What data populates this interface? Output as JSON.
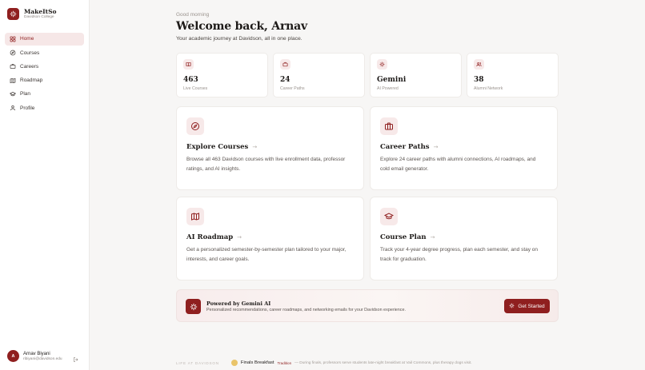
{
  "app": {
    "name": "MakeItSo",
    "subtitle": "Davidson College",
    "accent": "#8f1f1f"
  },
  "sidebar": {
    "items": [
      {
        "label": "Home",
        "icon": "grid-icon",
        "active": true
      },
      {
        "label": "Courses",
        "icon": "compass-icon"
      },
      {
        "label": "Careers",
        "icon": "briefcase-icon"
      },
      {
        "label": "Roadmap",
        "icon": "map-icon"
      },
      {
        "label": "Plan",
        "icon": "graduation-cap-icon"
      },
      {
        "label": "Profile",
        "icon": "user-icon"
      }
    ]
  },
  "user": {
    "initial": "A",
    "name": "Arnav Biyani",
    "email": "ribiyani@davidson.edu"
  },
  "header": {
    "greeting": "Good morning",
    "title": "Welcome back, Arnav",
    "subtitle": "Your academic journey at Davidson, all in one place."
  },
  "stats": [
    {
      "value": "463",
      "label": "Live Courses",
      "icon": "book-icon"
    },
    {
      "value": "24",
      "label": "Career Paths",
      "icon": "briefcase-icon"
    },
    {
      "value": "Gemini",
      "label": "AI Powered",
      "icon": "sparkle-icon"
    },
    {
      "value": "38",
      "label": "Alumni Network",
      "icon": "users-icon"
    }
  ],
  "cards": [
    {
      "title": "Explore Courses",
      "desc": "Browse all 463 Davidson courses with live enrollment data, professor ratings, and AI insights.",
      "icon": "compass-icon"
    },
    {
      "title": "Career Paths",
      "desc": "Explore 24 career paths with alumni connections, AI roadmaps, and cold email generator.",
      "icon": "briefcase-icon"
    },
    {
      "title": "AI Roadmap",
      "desc": "Get a personalized semester-by-semester plan tailored to your major, interests, and career goals.",
      "icon": "map-icon"
    },
    {
      "title": "Course Plan",
      "desc": "Track your 4-year degree progress, plan each semester, and stay on track for graduation.",
      "icon": "graduation-cap-icon"
    }
  ],
  "banner": {
    "title": "Powered by Gemini AI",
    "desc": "Personalized recommendations, career roadmaps, and networking emails for your Davidson experience.",
    "button": "Get Started"
  },
  "ticker": {
    "label": "LIFE AT DAVIDSON",
    "event": "Finals Breakfast",
    "tag": "Tradition",
    "desc": "— During finals, professors serve students late-night breakfast at Vail Commons, plus therapy dogs visit."
  },
  "arrow": "→"
}
